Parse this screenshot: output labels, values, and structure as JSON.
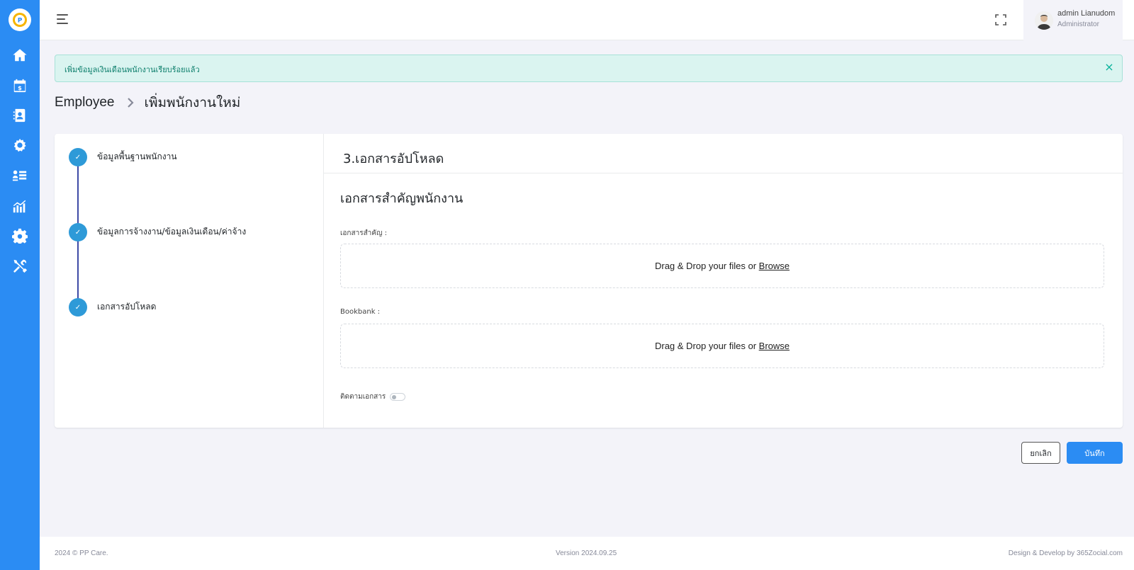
{
  "sidebar": {
    "logo_icon": "pp-care-logo-icon",
    "items": [
      {
        "icon": "home-icon"
      },
      {
        "icon": "calendar-dollar-icon"
      },
      {
        "icon": "address-book-icon"
      },
      {
        "icon": "team-gear-icon"
      },
      {
        "icon": "list-detail-icon"
      },
      {
        "icon": "chart-bar-icon"
      },
      {
        "icon": "settings-gear-icon"
      },
      {
        "icon": "tools-icon"
      }
    ],
    "color": "#2b8cf3"
  },
  "topbar": {
    "user_name": "admin Lianudom",
    "user_role": "Administrator"
  },
  "alert": {
    "message": "เพิ่มข้อมูลเงินเดือนพนักงานเรียบร้อยแล้ว",
    "close_symbol": "×"
  },
  "breadcrumb": {
    "root": "Employee",
    "current": "เพิ่มพนักงานใหม่"
  },
  "steps": [
    {
      "label": "ข้อมูลพื้นฐานพนักงาน",
      "done": true,
      "check": "✓"
    },
    {
      "label": "ข้อมูลการจ้างงาน/ข้อมูลเงินเดือน/ค่าจ้าง",
      "done": true,
      "check": "✓"
    },
    {
      "label": "เอกสารอัปโหลด",
      "done": true,
      "check": "✓"
    }
  ],
  "content": {
    "title": "3.เอกสารอัปโหลด",
    "section_title": "เอกสารสำคัญพนักงาน",
    "fields": [
      {
        "label": "เอกสารสำคัญ :",
        "dropzone_text": "Drag & Drop your files or ",
        "browse": "Browse"
      },
      {
        "label": "Bookbank :",
        "dropzone_text": "Drag & Drop your files or ",
        "browse": "Browse"
      }
    ],
    "toggle_label": "ติดตามเอกสาร",
    "toggle_on": false
  },
  "buttons": {
    "cancel": "ยกเลิก",
    "save": "บันทึก"
  },
  "footer": {
    "left": "2024 © PP Care.",
    "center": "Version 2024.09.25",
    "right": "Design & Develop by 365Zocial.com"
  }
}
